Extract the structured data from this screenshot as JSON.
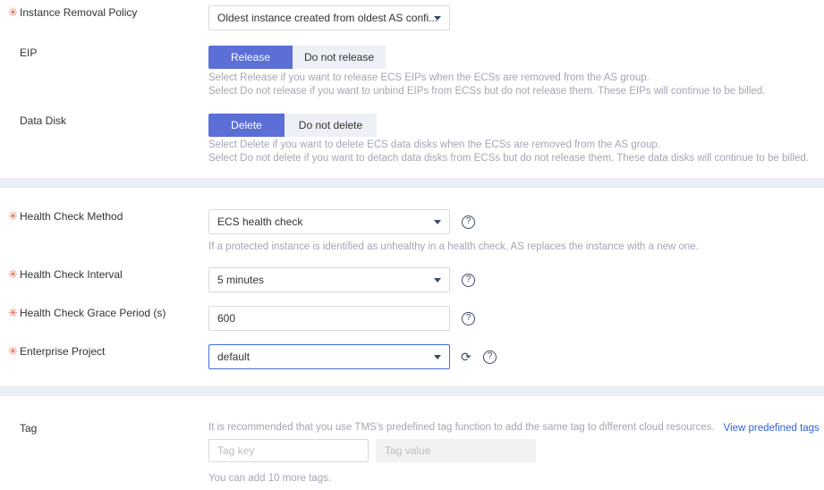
{
  "colors": {
    "accent_blue": "#5b6fd6",
    "link_blue": "#2f62d6",
    "required_star": "#e8614d",
    "hint_gray": "#a3a7b5",
    "band_gray": "#eceef5",
    "focus_border": "#3f6ddc"
  },
  "sections": {
    "removal": {
      "instance_removal_policy": {
        "label": "Instance Removal Policy",
        "required": true,
        "value": "Oldest instance created from oldest AS confi..."
      },
      "eip": {
        "label": "EIP",
        "required": false,
        "options": [
          "Release",
          "Do not release"
        ],
        "selected": "Release",
        "hint_line1": "Select Release if you want to release ECS EIPs when the ECSs are removed from the AS group.",
        "hint_line2": "Select Do not release if you want to unbind EIPs from ECSs but do not release them. These EIPs will continue to be billed."
      },
      "data_disk": {
        "label": "Data Disk",
        "required": false,
        "options": [
          "Delete",
          "Do not delete"
        ],
        "selected": "Delete",
        "hint_line1": "Select Delete if you want to delete ECS data disks when the ECSs are removed from the AS group.",
        "hint_line2": "Select Do not delete if you want to detach data disks from ECSs but do not release them. These data disks will continue to be billed."
      }
    },
    "health_check": {
      "method": {
        "label": "Health Check Method",
        "required": true,
        "value": "ECS health check",
        "hint": "If a protected instance is identified as unhealthy in a health check, AS replaces the instance with a new one.",
        "help_icon": "question-circle-icon"
      },
      "interval": {
        "label": "Health Check Interval",
        "required": true,
        "value": "5 minutes",
        "help_icon": "question-circle-icon"
      },
      "grace_period": {
        "label": "Health Check Grace Period (s)",
        "required": true,
        "value": "600",
        "help_icon": "question-circle-icon"
      },
      "enterprise_project": {
        "label": "Enterprise Project",
        "required": true,
        "value": "default",
        "refresh_icon": "refresh-icon",
        "help_icon": "question-circle-icon"
      }
    },
    "tag": {
      "label": "Tag",
      "required": false,
      "description": "It is recommended that you use TMS's predefined tag function to add the same tag to different cloud resources.",
      "view_predefined_tags_link": "View predefined tags",
      "refresh_icon": "refresh-icon",
      "tag_key_placeholder": "Tag key",
      "tag_value_placeholder": "Tag value",
      "tag_key_value": "",
      "tag_value_value": "",
      "remaining_note": "You can add 10 more tags."
    }
  }
}
